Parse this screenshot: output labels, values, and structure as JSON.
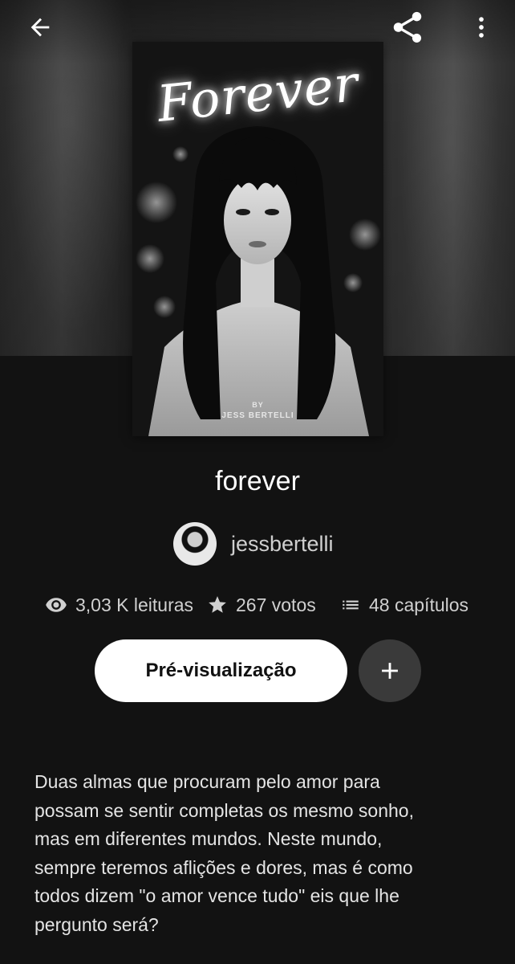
{
  "header": {
    "back_icon": "arrow-left-icon",
    "share_icon": "share-icon",
    "more_icon": "more-vertical-icon"
  },
  "cover": {
    "title_text": "Forever",
    "byline": "BY",
    "author_text": "JESS BERTELLI"
  },
  "story": {
    "title": "forever",
    "author": "jessbertelli"
  },
  "stats": {
    "reads": "3,03 K leituras",
    "votes": "267 votos",
    "chapters": "48 capítulos"
  },
  "actions": {
    "preview_label": "Pré-visualização",
    "add_icon": "plus-icon"
  },
  "description": "Duas almas que procuram pelo amor para\npossam se sentir completas os mesmo sonho,\nmas em diferentes mundos. Neste mundo,\nsempre teremos aflições e dores, mas é como\ntodos dizem \"o amor vence tudo\" eis que lhe\npergunto será?",
  "colors": {
    "background": "#121212",
    "preview_button": "#ffffff",
    "add_button": "#3a3a3a"
  }
}
